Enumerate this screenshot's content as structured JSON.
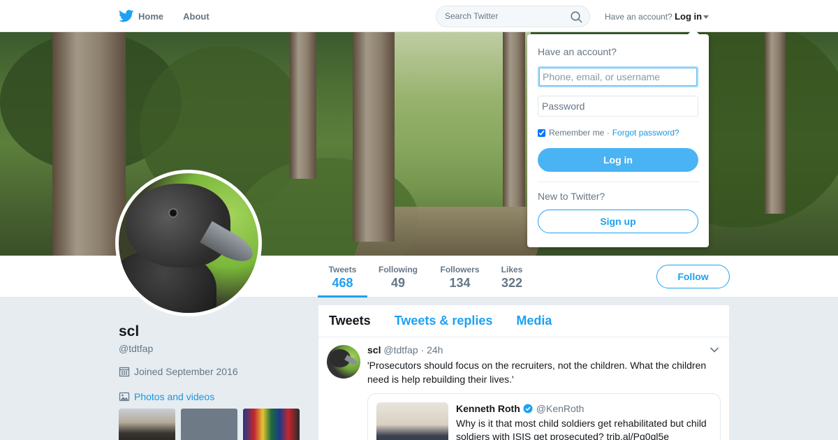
{
  "nav": {
    "home_label": "Home",
    "about_label": "About",
    "search_placeholder": "Search Twitter",
    "account_prompt": "Have an account?",
    "login_label": "Log in"
  },
  "colors": {
    "accent": "#1da1f2",
    "link": "#1b95e0",
    "page_bg": "#e6ecf0"
  },
  "profile": {
    "name": "scl",
    "handle": "@tdtfap",
    "joined": "Joined September 2016",
    "photos_label": "Photos and videos",
    "follow_label": "Follow",
    "stats": [
      {
        "label": "Tweets",
        "value": "468"
      },
      {
        "label": "Following",
        "value": "49"
      },
      {
        "label": "Followers",
        "value": "134"
      },
      {
        "label": "Likes",
        "value": "322"
      }
    ]
  },
  "timeline": {
    "tabs": [
      "Tweets",
      "Tweets & replies",
      "Media"
    ],
    "tweet": {
      "name": "scl",
      "handle": "@tdtfap",
      "separator": "·",
      "time": "24h",
      "text": "'Prosecutors should focus on the recruiters, not the children. What the children need is help rebuilding their lives.'",
      "quote": {
        "name": "Kenneth Roth",
        "handle": "@KenRoth",
        "text": "Why is it that most child soldiers get rehabilitated but child soldiers with ISIS get prosecuted? trib.al/Pg0ql5e"
      }
    }
  },
  "login_dropdown": {
    "title": "Have an account?",
    "username_placeholder": "Phone, email, or username",
    "password_placeholder": "Password",
    "remember_label": "Remember me ·",
    "forgot_label": "Forgot password?",
    "login_button": "Log in",
    "new_prompt": "New to Twitter?",
    "signup_button": "Sign up"
  }
}
